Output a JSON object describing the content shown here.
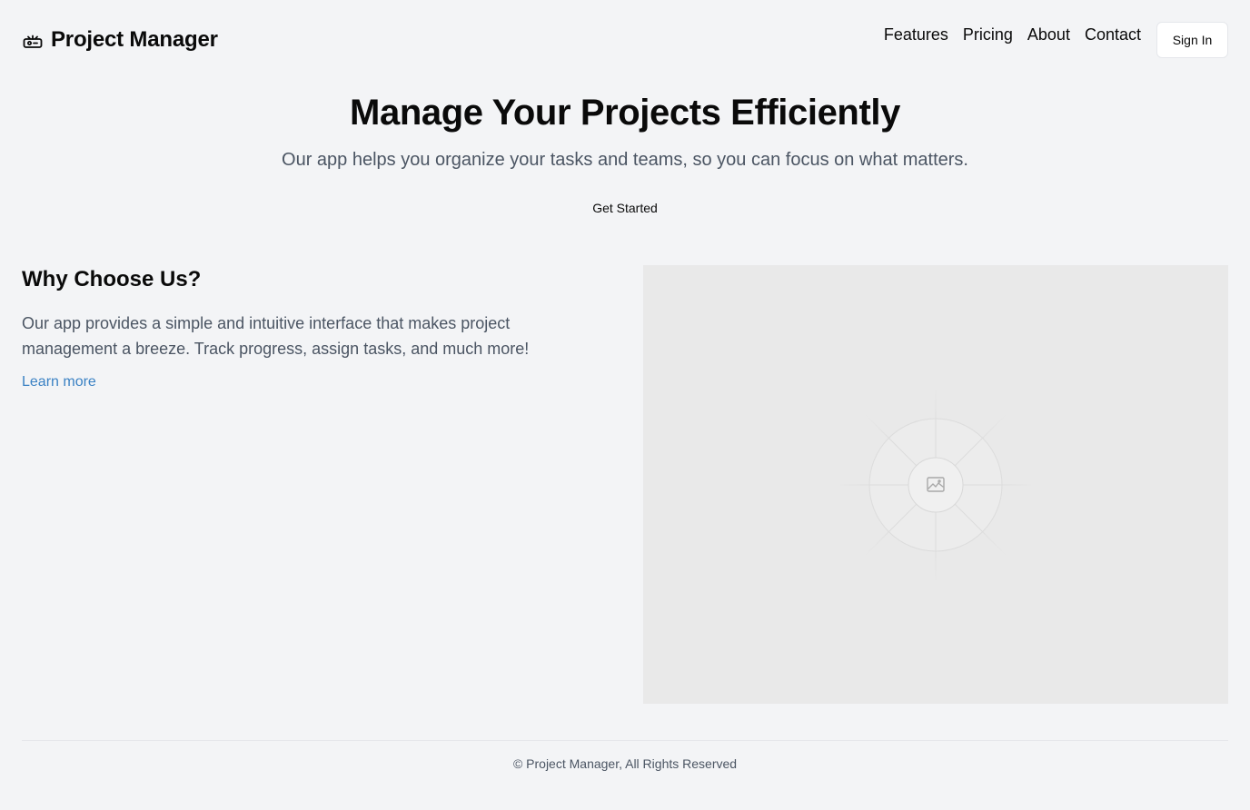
{
  "header": {
    "brand": "Project Manager",
    "nav": [
      "Features",
      "Pricing",
      "About",
      "Contact"
    ],
    "sign_in": "Sign In"
  },
  "hero": {
    "title": "Manage Your Projects Efficiently",
    "subtitle": "Our app helps you organize your tasks and teams, so you can focus on what matters.",
    "cta": "Get Started"
  },
  "why": {
    "title": "Why Choose Us?",
    "text": "Our app provides a simple and intuitive interface that makes project management a breeze. Track progress, assign tasks, and much more!",
    "link": "Learn more"
  },
  "image_placeholder": {
    "icon": "image-icon"
  },
  "footer": {
    "text": "© Project Manager, All Rights Reserved"
  },
  "colors": {
    "background": "#f3f4f6",
    "muted_text": "#4b5563",
    "link": "#3b82c4",
    "placeholder_bg": "#e9e9e9"
  }
}
